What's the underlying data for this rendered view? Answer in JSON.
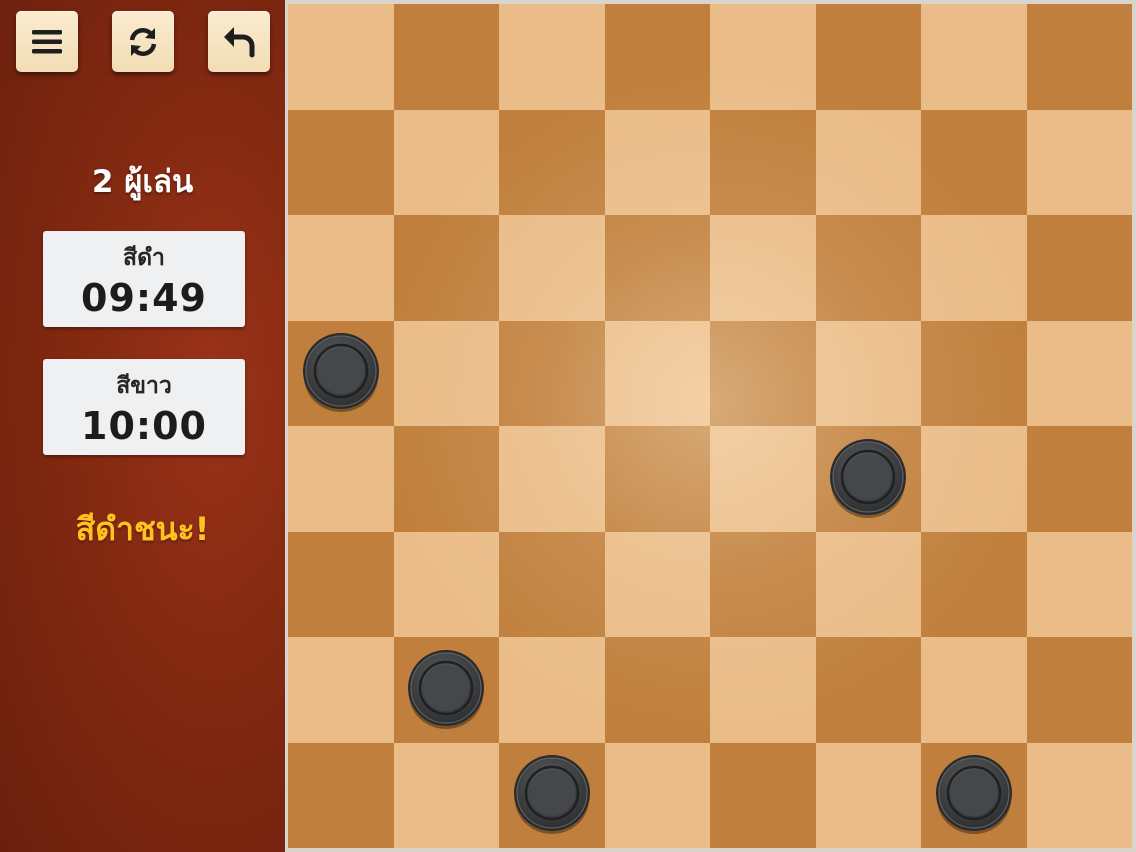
{
  "toolbar": {
    "menu_icon": "hamburger-menu-icon",
    "restart_icon": "restart-icon",
    "undo_icon": "undo-arrow-icon"
  },
  "sidebar": {
    "mode_title": "2 ผู้เล่น",
    "clocks": [
      {
        "label": "สีดำ",
        "time": "09:49"
      },
      {
        "label": "สีขาว",
        "time": "10:00"
      }
    ],
    "status": "สีดำชนะ!"
  },
  "board": {
    "rows": 8,
    "cols": 8,
    "light_color": "#eabc88",
    "dark_color": "#c07f3c",
    "pieces": [
      {
        "color": "black",
        "row": 3,
        "col": 0
      },
      {
        "color": "black",
        "row": 4,
        "col": 5
      },
      {
        "color": "black",
        "row": 6,
        "col": 1
      },
      {
        "color": "black",
        "row": 7,
        "col": 2
      },
      {
        "color": "black",
        "row": 7,
        "col": 6
      }
    ]
  },
  "colors": {
    "sidebar": "#7e2710",
    "status_text": "#ffc21f",
    "button_face": "#f5e2bd",
    "piece_black": "#3a3b3c"
  }
}
